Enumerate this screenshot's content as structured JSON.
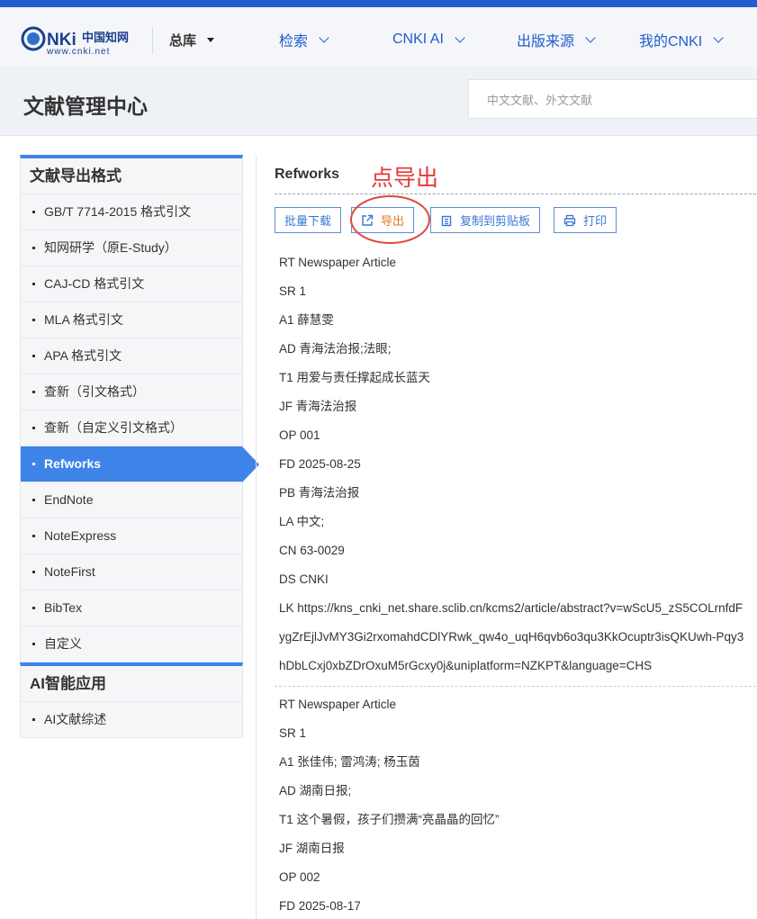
{
  "logo": {
    "text": "中国知网",
    "url_text": "www.cnki.net"
  },
  "database_select": {
    "label": "总库"
  },
  "nav": [
    {
      "label": "检索"
    },
    {
      "label": "CNKI AI"
    },
    {
      "label": "出版来源"
    },
    {
      "label": "我的CNKI"
    }
  ],
  "header": {
    "title": "文献管理中心",
    "search_placeholder": "中文文献、外文文献"
  },
  "sidebar": {
    "groups": [
      {
        "title": "文献导出格式",
        "items": [
          {
            "label": "GB/T 7714-2015 格式引文"
          },
          {
            "label": "知网研学（原E-Study）"
          },
          {
            "label": "CAJ-CD 格式引文"
          },
          {
            "label": "MLA 格式引文"
          },
          {
            "label": "APA 格式引文"
          },
          {
            "label": "查新（引文格式）"
          },
          {
            "label": "查新（自定义引文格式）"
          },
          {
            "label": "Refworks",
            "active": true
          },
          {
            "label": "EndNote"
          },
          {
            "label": "NoteExpress"
          },
          {
            "label": "NoteFirst"
          },
          {
            "label": "BibTex"
          },
          {
            "label": "自定义"
          }
        ]
      },
      {
        "title": "AI智能应用",
        "items": [
          {
            "label": "AI文献综述"
          }
        ]
      }
    ]
  },
  "content": {
    "format_title": "Refworks",
    "annotation": "点导出",
    "toolbar": {
      "batch_download": "批量下载",
      "export": "导出",
      "copy": "复制到剪贴板",
      "print": "打印"
    },
    "records": [
      [
        "RT Newspaper Article",
        "SR 1",
        "A1  薛慧雯",
        "AD 青海法治报;法眼;",
        "T1 用爱与责任撑起成长蓝天",
        "JF 青海法治报",
        "OP 001",
        "FD 2025-08-25",
        "PB 青海法治报",
        "LA 中文;",
        "CN 63-0029",
        "DS CNKI",
        "LK https://kns_cnki_net.share.sclib.cn/kcms2/article/abstract?v=wScU5_zS5COLrnfdF",
        "ygZrEjlJvMY3Gi2rxomahdCDlYRwk_qw4o_uqH6qvb6o3qu3KkOcuptr3isQKUwh-Pqy3",
        "hDbLCxj0xbZDrOxuM5rGcxy0j&uniplatform=NZKPT&language=CHS"
      ],
      [
        "RT Newspaper Article",
        "SR 1",
        "A1  张佳伟; 雷鸿涛; 杨玉茵",
        "AD 湖南日报;",
        "T1 这个暑假，孩子们攒满“亮晶晶的回忆”",
        "JF 湖南日报",
        "OP 002",
        "FD 2025-08-17"
      ]
    ]
  },
  "colors": {
    "brand_blue": "#1e5ed1",
    "active_blue": "#3e84e8",
    "annotation_red": "#e53935",
    "export_orange": "#e8791f"
  }
}
